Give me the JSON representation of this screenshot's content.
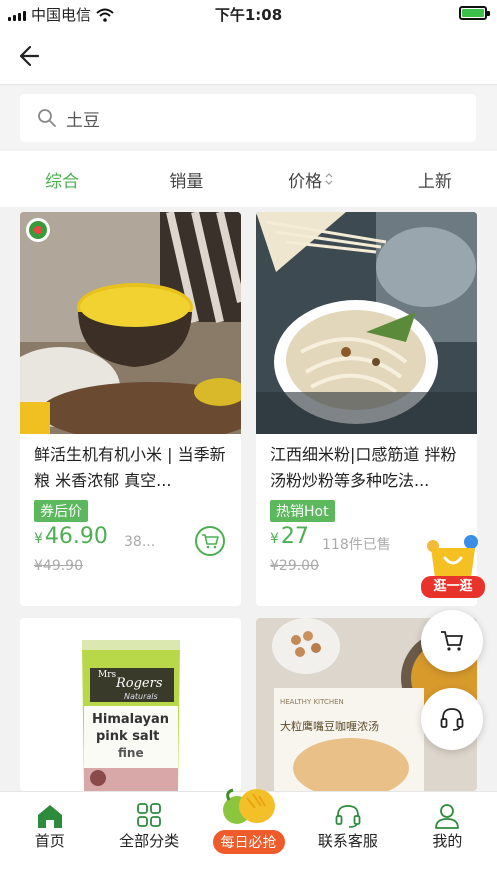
{
  "status_bar": {
    "carrier": "中国电信",
    "time": "下午1:08"
  },
  "search": {
    "query": "土豆"
  },
  "sort_tabs": [
    {
      "label": "综合",
      "active": true
    },
    {
      "label": "销量",
      "active": false
    },
    {
      "label": "价格",
      "active": false
    },
    {
      "label": "上新",
      "active": false
    }
  ],
  "products": [
    {
      "title": "鲜活生机有机小米 | 当季新粮 米香浓郁 真空...",
      "tag": "券后价",
      "currency": "¥",
      "price": "46.90",
      "sold": "38...",
      "original_price": "¥49.90"
    },
    {
      "title": "江西细米粉|口感筋道 拌粉汤粉炒粉等多种吃法...",
      "tag": "热销Hot",
      "currency": "¥",
      "price": "27",
      "sold": "118件已售",
      "original_price": "¥29.00"
    },
    {
      "image_text_brand_line1": "Mrs",
      "image_text_brand_line2": "Rogers",
      "image_text_sub": "Naturals",
      "image_text_line1": "Himalayan",
      "image_text_line2": "pink salt",
      "image_text_line3": "fine"
    },
    {
      "image_text_brand": "HEALTHY KITCHEN",
      "image_text_title": "大粒鹰嘴豆咖喱浓汤"
    }
  ],
  "floating": {
    "stroll_label": "逛一逛"
  },
  "bottom_nav": [
    {
      "label": "首页",
      "icon": "home-icon",
      "active": true
    },
    {
      "label": "全部分类",
      "icon": "grid-icon",
      "active": false
    },
    {
      "label": "每日必抢",
      "icon": "mango-icon",
      "active": false
    },
    {
      "label": "联系客服",
      "icon": "headset-icon",
      "active": false
    },
    {
      "label": "我的",
      "icon": "user-icon",
      "active": false
    }
  ],
  "colors": {
    "accent": "#4caf50",
    "tag_bg": "#5cb85c",
    "promo": "#ef5b2a"
  }
}
